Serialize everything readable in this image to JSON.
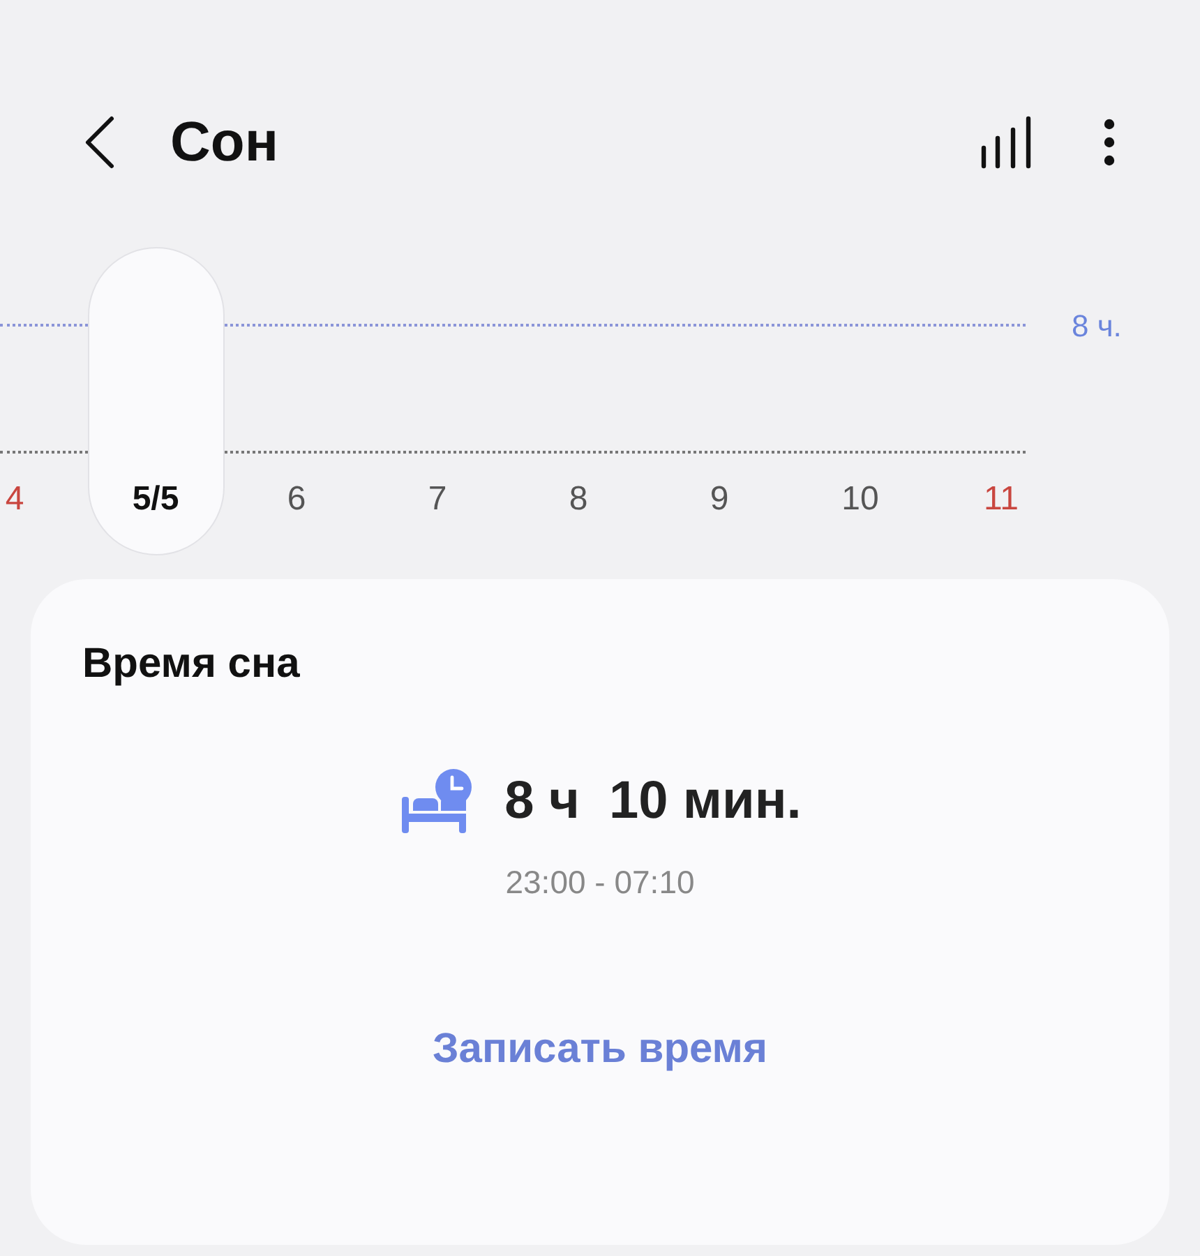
{
  "header": {
    "title": "Сон"
  },
  "chart": {
    "goal_label": "8 ч.",
    "days": [
      {
        "label": "4",
        "selected": false,
        "weekend": true
      },
      {
        "label": "5/5",
        "selected": true,
        "weekend": false
      },
      {
        "label": "6",
        "selected": false,
        "weekend": false
      },
      {
        "label": "7",
        "selected": false,
        "weekend": false
      },
      {
        "label": "8",
        "selected": false,
        "weekend": false
      },
      {
        "label": "9",
        "selected": false,
        "weekend": false
      },
      {
        "label": "10",
        "selected": false,
        "weekend": false
      },
      {
        "label": "11",
        "selected": false,
        "weekend": true
      }
    ]
  },
  "card": {
    "title": "Время сна",
    "duration_hours": "8 ч",
    "duration_minutes": "10 мин.",
    "range": "23:00 - 07:10",
    "action": "Записать время"
  }
}
